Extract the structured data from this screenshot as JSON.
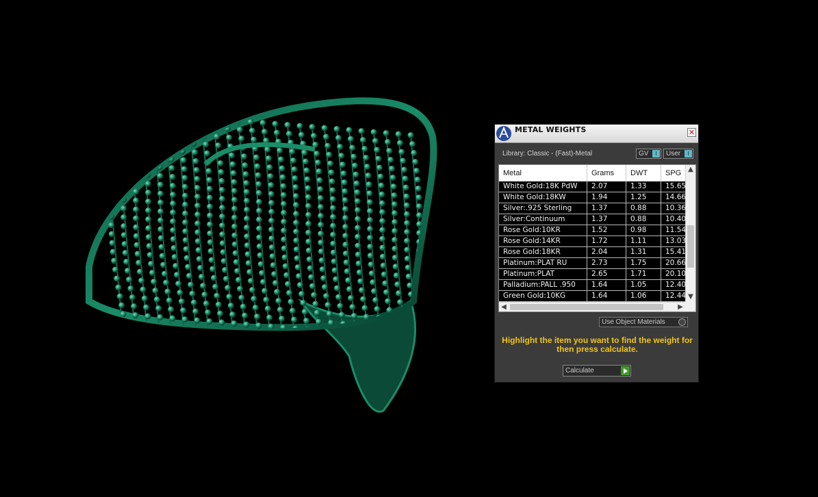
{
  "panel": {
    "title": "METAL WEIGHTS",
    "close_glyph": "✕",
    "library_label": "Library: Classic - (Fast)-Metal",
    "gv_label": "GV",
    "user_label": "User",
    "use_object_materials_label": "Use Object Materials",
    "hint": "Highlight the item you want to find the weight for then press calculate.",
    "calculate_label": "Calculate"
  },
  "table": {
    "headers": [
      "Metal",
      "Grams",
      "DWT",
      "SPG"
    ],
    "rows": [
      [
        "White Gold:18K PdW",
        "2.07",
        "1.33",
        "15.65"
      ],
      [
        "White Gold:18KW",
        "1.94",
        "1.25",
        "14.66"
      ],
      [
        "Silver:.925 Sterling",
        "1.37",
        "0.88",
        "10.36"
      ],
      [
        "Silver:Continuum",
        "1.37",
        "0.88",
        "10.40"
      ],
      [
        "Rose Gold:10KR",
        "1.52",
        "0.98",
        "11.54"
      ],
      [
        "Rose Gold:14KR",
        "1.72",
        "1.11",
        "13.03"
      ],
      [
        "Rose Gold:18KR",
        "2.04",
        "1.31",
        "15.41"
      ],
      [
        "Platinum:PLAT RU",
        "2.73",
        "1.75",
        "20.66"
      ],
      [
        "Platinum:PLAT",
        "2.65",
        "1.71",
        "20.10"
      ],
      [
        "Palladium:PALL .950",
        "1.64",
        "1.05",
        "12.40"
      ],
      [
        "Green Gold:10KG",
        "1.64",
        "1.06",
        "12.44"
      ]
    ]
  },
  "icons": {
    "logo": "app-logo-icon",
    "close": "close-icon",
    "scroll_up": "chevron-up-icon",
    "scroll_down": "chevron-down-icon",
    "scroll_left": "chevron-left-icon",
    "scroll_right": "chevron-right-icon",
    "calculate": "play-icon"
  },
  "colors": {
    "background": "#000000",
    "model": "#0f6e52",
    "panel": "#3b3b3b",
    "hint": "#f0c419",
    "toggle_accent": "#5fb8c8",
    "calculate_accent": "#3f9b2a"
  }
}
